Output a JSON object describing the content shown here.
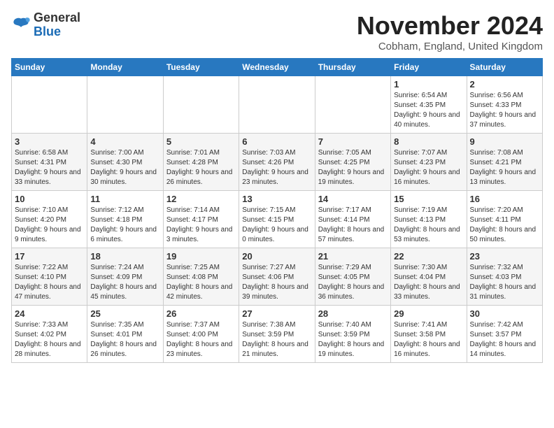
{
  "header": {
    "logo_general": "General",
    "logo_blue": "Blue",
    "month_title": "November 2024",
    "location": "Cobham, England, United Kingdom"
  },
  "weekdays": [
    "Sunday",
    "Monday",
    "Tuesday",
    "Wednesday",
    "Thursday",
    "Friday",
    "Saturday"
  ],
  "weeks": [
    [
      {
        "day": "",
        "info": ""
      },
      {
        "day": "",
        "info": ""
      },
      {
        "day": "",
        "info": ""
      },
      {
        "day": "",
        "info": ""
      },
      {
        "day": "",
        "info": ""
      },
      {
        "day": "1",
        "info": "Sunrise: 6:54 AM\nSunset: 4:35 PM\nDaylight: 9 hours\nand 40 minutes."
      },
      {
        "day": "2",
        "info": "Sunrise: 6:56 AM\nSunset: 4:33 PM\nDaylight: 9 hours\nand 37 minutes."
      }
    ],
    [
      {
        "day": "3",
        "info": "Sunrise: 6:58 AM\nSunset: 4:31 PM\nDaylight: 9 hours\nand 33 minutes."
      },
      {
        "day": "4",
        "info": "Sunrise: 7:00 AM\nSunset: 4:30 PM\nDaylight: 9 hours\nand 30 minutes."
      },
      {
        "day": "5",
        "info": "Sunrise: 7:01 AM\nSunset: 4:28 PM\nDaylight: 9 hours\nand 26 minutes."
      },
      {
        "day": "6",
        "info": "Sunrise: 7:03 AM\nSunset: 4:26 PM\nDaylight: 9 hours\nand 23 minutes."
      },
      {
        "day": "7",
        "info": "Sunrise: 7:05 AM\nSunset: 4:25 PM\nDaylight: 9 hours\nand 19 minutes."
      },
      {
        "day": "8",
        "info": "Sunrise: 7:07 AM\nSunset: 4:23 PM\nDaylight: 9 hours\nand 16 minutes."
      },
      {
        "day": "9",
        "info": "Sunrise: 7:08 AM\nSunset: 4:21 PM\nDaylight: 9 hours\nand 13 minutes."
      }
    ],
    [
      {
        "day": "10",
        "info": "Sunrise: 7:10 AM\nSunset: 4:20 PM\nDaylight: 9 hours\nand 9 minutes."
      },
      {
        "day": "11",
        "info": "Sunrise: 7:12 AM\nSunset: 4:18 PM\nDaylight: 9 hours\nand 6 minutes."
      },
      {
        "day": "12",
        "info": "Sunrise: 7:14 AM\nSunset: 4:17 PM\nDaylight: 9 hours\nand 3 minutes."
      },
      {
        "day": "13",
        "info": "Sunrise: 7:15 AM\nSunset: 4:15 PM\nDaylight: 9 hours\nand 0 minutes."
      },
      {
        "day": "14",
        "info": "Sunrise: 7:17 AM\nSunset: 4:14 PM\nDaylight: 8 hours\nand 57 minutes."
      },
      {
        "day": "15",
        "info": "Sunrise: 7:19 AM\nSunset: 4:13 PM\nDaylight: 8 hours\nand 53 minutes."
      },
      {
        "day": "16",
        "info": "Sunrise: 7:20 AM\nSunset: 4:11 PM\nDaylight: 8 hours\nand 50 minutes."
      }
    ],
    [
      {
        "day": "17",
        "info": "Sunrise: 7:22 AM\nSunset: 4:10 PM\nDaylight: 8 hours\nand 47 minutes."
      },
      {
        "day": "18",
        "info": "Sunrise: 7:24 AM\nSunset: 4:09 PM\nDaylight: 8 hours\nand 45 minutes."
      },
      {
        "day": "19",
        "info": "Sunrise: 7:25 AM\nSunset: 4:08 PM\nDaylight: 8 hours\nand 42 minutes."
      },
      {
        "day": "20",
        "info": "Sunrise: 7:27 AM\nSunset: 4:06 PM\nDaylight: 8 hours\nand 39 minutes."
      },
      {
        "day": "21",
        "info": "Sunrise: 7:29 AM\nSunset: 4:05 PM\nDaylight: 8 hours\nand 36 minutes."
      },
      {
        "day": "22",
        "info": "Sunrise: 7:30 AM\nSunset: 4:04 PM\nDaylight: 8 hours\nand 33 minutes."
      },
      {
        "day": "23",
        "info": "Sunrise: 7:32 AM\nSunset: 4:03 PM\nDaylight: 8 hours\nand 31 minutes."
      }
    ],
    [
      {
        "day": "24",
        "info": "Sunrise: 7:33 AM\nSunset: 4:02 PM\nDaylight: 8 hours\nand 28 minutes."
      },
      {
        "day": "25",
        "info": "Sunrise: 7:35 AM\nSunset: 4:01 PM\nDaylight: 8 hours\nand 26 minutes."
      },
      {
        "day": "26",
        "info": "Sunrise: 7:37 AM\nSunset: 4:00 PM\nDaylight: 8 hours\nand 23 minutes."
      },
      {
        "day": "27",
        "info": "Sunrise: 7:38 AM\nSunset: 3:59 PM\nDaylight: 8 hours\nand 21 minutes."
      },
      {
        "day": "28",
        "info": "Sunrise: 7:40 AM\nSunset: 3:59 PM\nDaylight: 8 hours\nand 19 minutes."
      },
      {
        "day": "29",
        "info": "Sunrise: 7:41 AM\nSunset: 3:58 PM\nDaylight: 8 hours\nand 16 minutes."
      },
      {
        "day": "30",
        "info": "Sunrise: 7:42 AM\nSunset: 3:57 PM\nDaylight: 8 hours\nand 14 minutes."
      }
    ]
  ]
}
